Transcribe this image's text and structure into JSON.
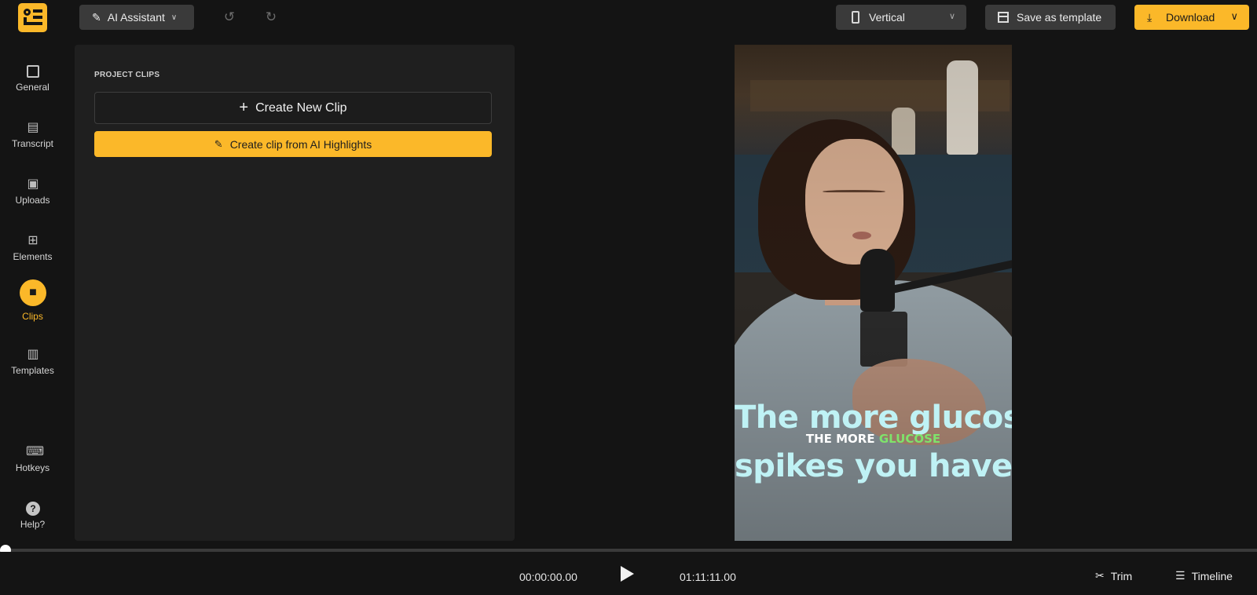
{
  "topbar": {
    "logo_icon": "app-logo",
    "ai_assistant_label": "AI Assistant",
    "aspect_label": "Vertical",
    "save_template_label": "Save as template",
    "download_label": "Download",
    "accent_color": "#fbb829"
  },
  "sidebar": {
    "items": [
      {
        "label": "General",
        "icon": "sliders-icon"
      },
      {
        "label": "Transcript",
        "icon": "document-icon"
      },
      {
        "label": "Uploads",
        "icon": "folder-plus-icon"
      },
      {
        "label": "Elements",
        "icon": "grid-icon"
      },
      {
        "label": "Clips",
        "icon": "video-camera-icon",
        "active": true
      },
      {
        "label": "Templates",
        "icon": "layout-icon"
      }
    ],
    "bottom_items": [
      {
        "label": "Hotkeys",
        "icon": "keyboard-icon"
      },
      {
        "label": "Help?",
        "icon": "help-icon"
      }
    ]
  },
  "panel": {
    "section_title": "PROJECT CLIPS",
    "create_new_clip": "Create New Clip",
    "create_ai_clip": "Create clip from AI Highlights"
  },
  "video": {
    "caption_line1": "The more glucose",
    "caption_small_prefix": "THE MORE ",
    "caption_small_highlight": "GLUCOSE",
    "caption_line2": "spikes you have,"
  },
  "player": {
    "current_time": "00:00:00.00",
    "total_time": "01:11:11.00",
    "trim_label": "Trim",
    "timeline_label": "Timeline"
  }
}
